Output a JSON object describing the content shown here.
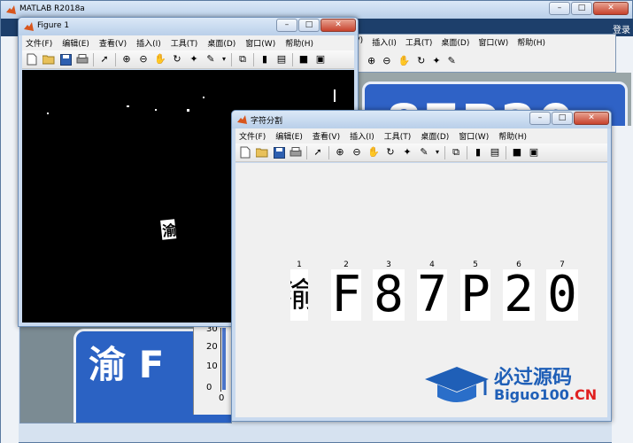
{
  "matlab": {
    "title": "MATLAB R2018a",
    "corner_label": "登录"
  },
  "background_plate": "87P20",
  "background_left_plate": "渝 F",
  "histogram": {
    "ticks": [
      "30",
      "20",
      "10",
      "0",
      "0"
    ]
  },
  "figure1": {
    "title": "Figure 1",
    "menu": [
      "文件(F)",
      "编辑(E)",
      "查看(V)",
      "插入(I)",
      "工具(T)",
      "桌面(D)",
      "窗口(W)",
      "帮助(H)"
    ],
    "plate_text": "渝F·87P2"
  },
  "figure_split": {
    "title": "字符分割",
    "menu": [
      "文件(F)",
      "编辑(E)",
      "查看(V)",
      "插入(I)",
      "工具(T)",
      "桌面(D)",
      "窗口(W)",
      "帮助(H)"
    ],
    "chars": [
      {
        "num": "1",
        "ch": "渝"
      },
      {
        "num": "2",
        "ch": "F"
      },
      {
        "num": "3",
        "ch": "8"
      },
      {
        "num": "4",
        "ch": "7"
      },
      {
        "num": "5",
        "ch": "P"
      },
      {
        "num": "6",
        "ch": "2"
      },
      {
        "num": "7",
        "ch": "0"
      }
    ]
  },
  "stray_menu": [
    "(V)",
    "插入(I)",
    "工具(T)",
    "桌面(D)",
    "窗口(W)",
    "帮助(H)"
  ],
  "watermark": {
    "line1": "必过源码",
    "line2_prefix": "Biguo100",
    "line2_suffix": ".CN"
  },
  "colors": {
    "plate_blue": "#2f62c6",
    "title_gradient_top": "#dbe8f7",
    "watermark_blue": "#1f5fb7",
    "watermark_red": "#e02020"
  }
}
